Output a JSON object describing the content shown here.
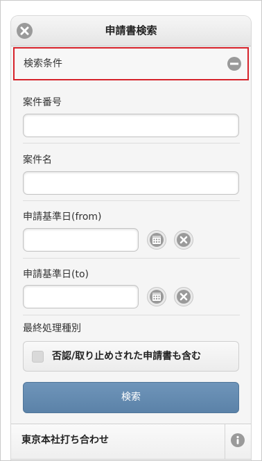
{
  "header": {
    "title": "申請書検索"
  },
  "collapsible": {
    "title": "検索条件"
  },
  "fields": {
    "case_number": {
      "label": "案件番号",
      "value": ""
    },
    "case_name": {
      "label": "案件名",
      "value": ""
    },
    "date_from": {
      "label": "申請基準日(from)",
      "value": ""
    },
    "date_to": {
      "label": "申請基準日(to)",
      "value": ""
    },
    "final_type": {
      "label": "最終処理種別"
    }
  },
  "checkbox": {
    "label": "否認/取り止めされた申請書も含む",
    "checked": false
  },
  "buttons": {
    "search": "検索"
  },
  "results": [
    {
      "title": "東京本社打ち合わせ"
    }
  ],
  "icons": {
    "close": "close-icon",
    "collapse": "minus-icon",
    "calendar": "calendar-icon",
    "clear": "clear-icon",
    "info": "info-icon"
  },
  "colors": {
    "highlight_border": "#d6222a",
    "primary_button": "#6389ae",
    "icon_gray": "#9a9a9a"
  }
}
